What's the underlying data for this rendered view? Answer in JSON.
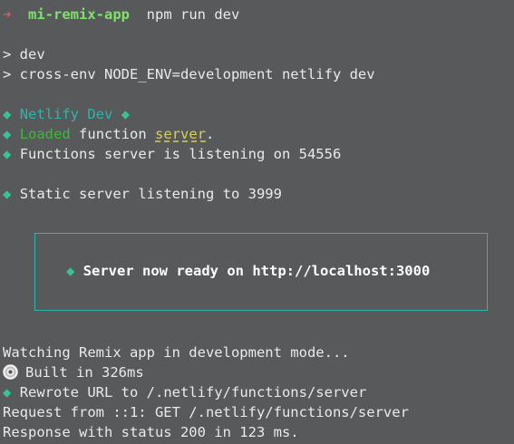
{
  "prompt": {
    "arrow_icon": "➜",
    "app_name": "mi-remix-app",
    "command": "npm run dev"
  },
  "npm_output": {
    "line1": "> dev",
    "line2": "> cross-env NODE_ENV=development netlify dev"
  },
  "netlify": {
    "diamond": "◆",
    "title": "Netlify Dev",
    "loaded_word": "Loaded",
    "function_word": "function",
    "server_word": "server",
    "period": ".",
    "functions_listening": "Functions server is listening on 54556",
    "static_listening": "Static server listening to 3999"
  },
  "ready_box": {
    "text": "Server now ready on http://localhost:3000"
  },
  "remix_output": {
    "watching": "Watching Remix app in development mode...",
    "built": "Built in 326ms",
    "rewrote": "Rewrote URL to /.netlify/functions/server",
    "request": "Request from ::1: GET /.netlify/functions/server",
    "response": "Response with status 200 in 123 ms."
  },
  "colors": {
    "background": "#58595b",
    "text": "#eaeaea",
    "arrow": "#e0556b",
    "app_name": "#7fe06c",
    "diamond": "#37c39a",
    "teal": "#2fb5a8",
    "loaded": "#3db83a",
    "server": "#d6cf5a"
  },
  "icons": {
    "prompt": "arrow-right-icon",
    "bullet": "diamond-icon",
    "built": "cd-disc-icon"
  }
}
